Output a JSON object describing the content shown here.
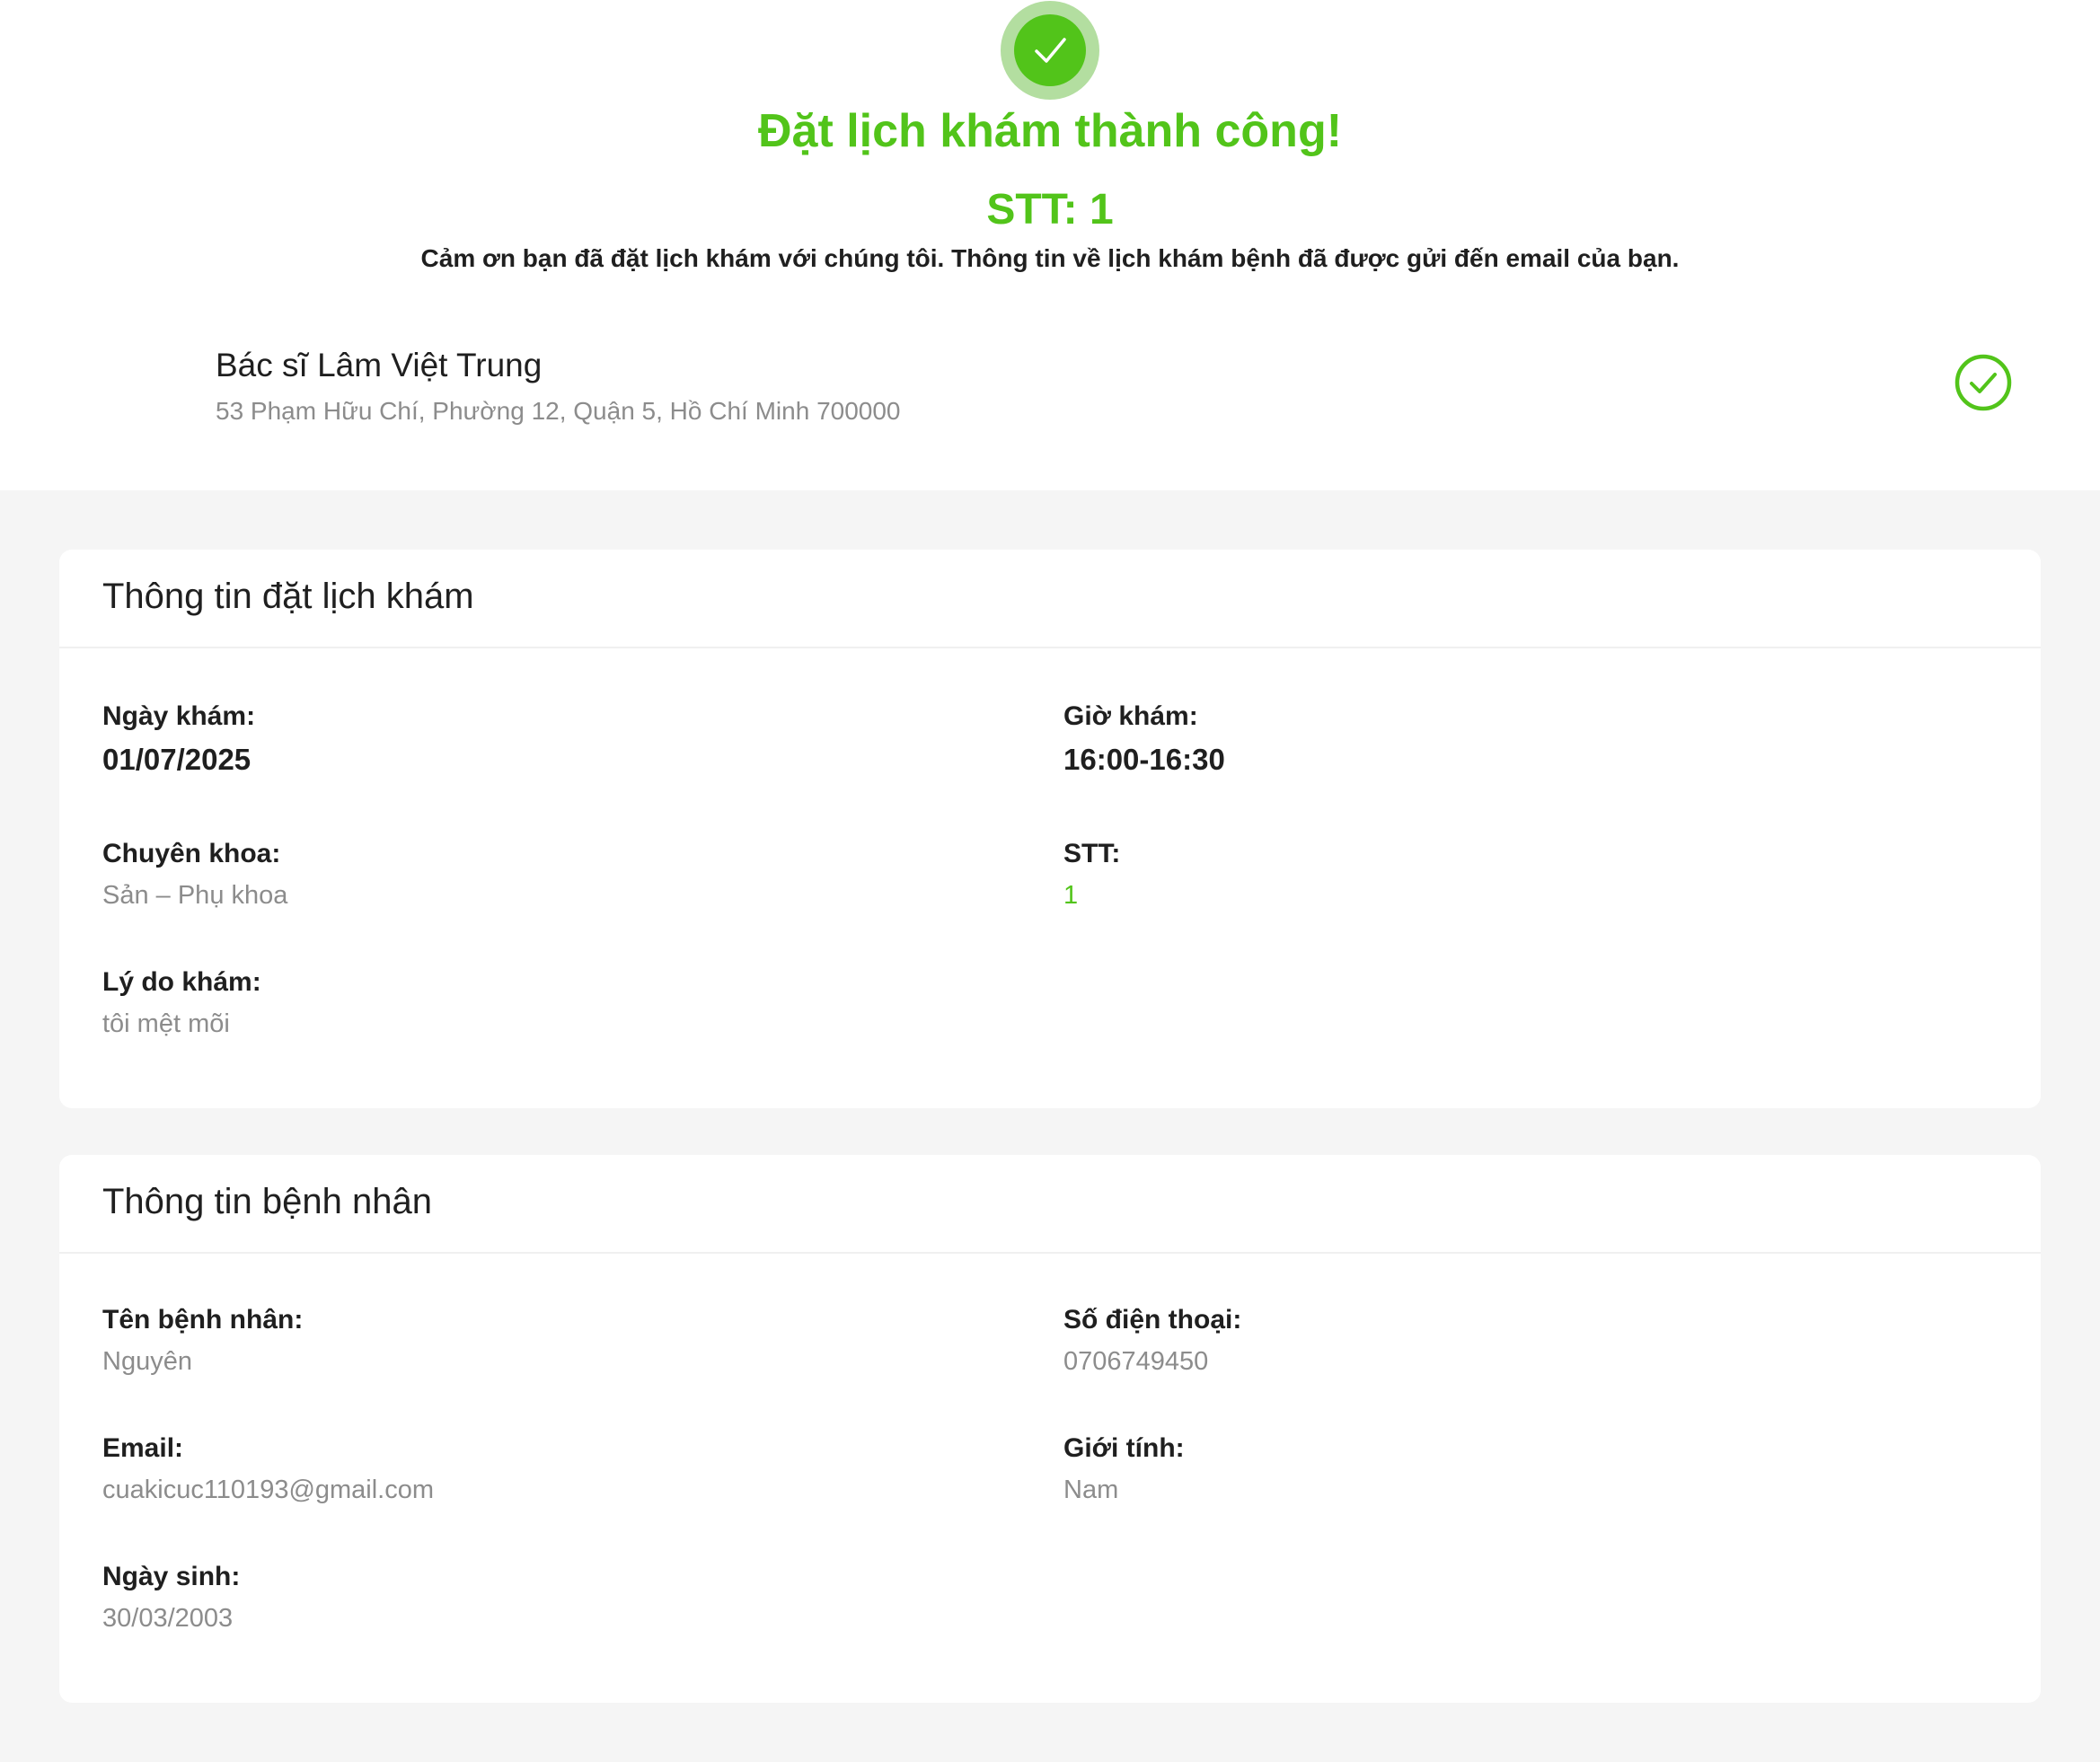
{
  "success": {
    "icon": "check-icon",
    "title": "Đặt lịch khám thành công!",
    "stt_text": "STT: 1",
    "message": "Cảm ơn bạn đã đặt lịch khám với chúng tôi. Thông tin về lịch khám bệnh đã được gửi đến email của bạn.",
    "accent_color": "#52c41a"
  },
  "doctor": {
    "name": "Bác sĩ Lâm Việt Trung",
    "address": "53 Phạm Hữu Chí, Phường 12, Quận 5, Hồ Chí Minh 700000",
    "status_icon": "check-circle-icon"
  },
  "booking": {
    "title": "Thông tin đặt lịch khám",
    "date_label": "Ngày khám:",
    "date_value": "01/07/2025",
    "time_label": "Giờ khám:",
    "time_value": "16:00-16:30",
    "specialty_label": "Chuyên khoa:",
    "specialty_value": "Sản – Phụ khoa",
    "stt_label": "STT:",
    "stt_value": "1",
    "reason_label": "Lý do khám:",
    "reason_value": "tôi mệt mõi"
  },
  "patient": {
    "title": "Thông tin bệnh nhân",
    "name_label": "Tên bệnh nhân:",
    "name_value": "Nguyên",
    "phone_label": "Số điện thoại:",
    "phone_value": "0706749450",
    "email_label": "Email:",
    "email_value": "cuakicuc110193@gmail.com",
    "gender_label": "Giới tính:",
    "gender_value": "Nam",
    "dob_label": "Ngày sinh:",
    "dob_value": "30/03/2003"
  }
}
